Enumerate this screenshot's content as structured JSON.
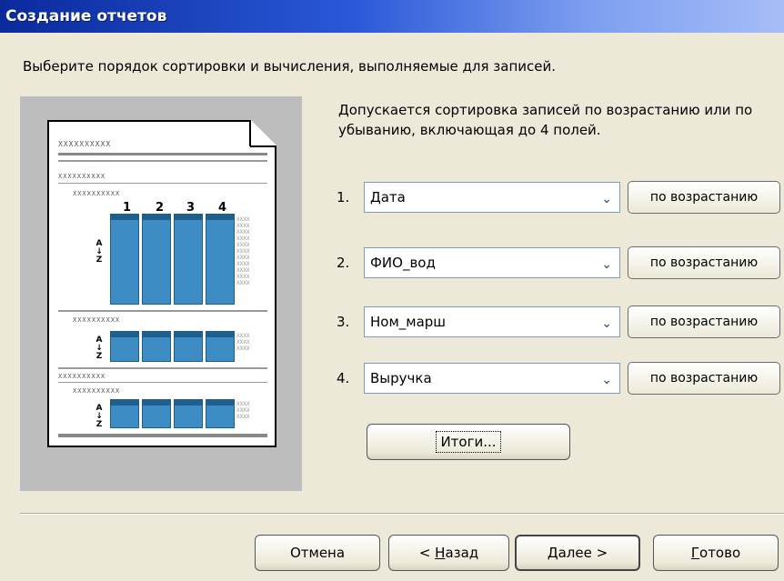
{
  "window": {
    "title": "Создание отчетов"
  },
  "instruction": "Выберите порядок сортировки и вычисления, выполняемые для записей.",
  "description": "Допускается сортировка записей по возрастанию или по убыванию, включающая до 4 полей.",
  "preview": {
    "column_numbers": [
      "1",
      "2",
      "3",
      "4"
    ],
    "placeholder": "XXXXXXXXXX",
    "sort_glyph": "A↓Z"
  },
  "sort_fields": [
    {
      "number": "1.",
      "field": "Дата",
      "order": "по возрастанию"
    },
    {
      "number": "2.",
      "field": "ФИО_вод",
      "order": "по возрастанию"
    },
    {
      "number": "3.",
      "field": "Ном_марш",
      "order": "по возрастанию"
    },
    {
      "number": "4.",
      "field": "Выручка",
      "order": "по возрастанию"
    }
  ],
  "totals_button": "Итоги...",
  "footer": {
    "cancel": "Отмена",
    "back_prefix": "< ",
    "back_accel": "Н",
    "back_rest": "азад",
    "next_accel": "Д",
    "next_rest": "алее >",
    "finish_accel": "Г",
    "finish_rest": "отово"
  },
  "colors": {
    "accent": "#3d8cc4",
    "title_start": "#0a2a9c",
    "title_end": "#a6bdf7"
  }
}
